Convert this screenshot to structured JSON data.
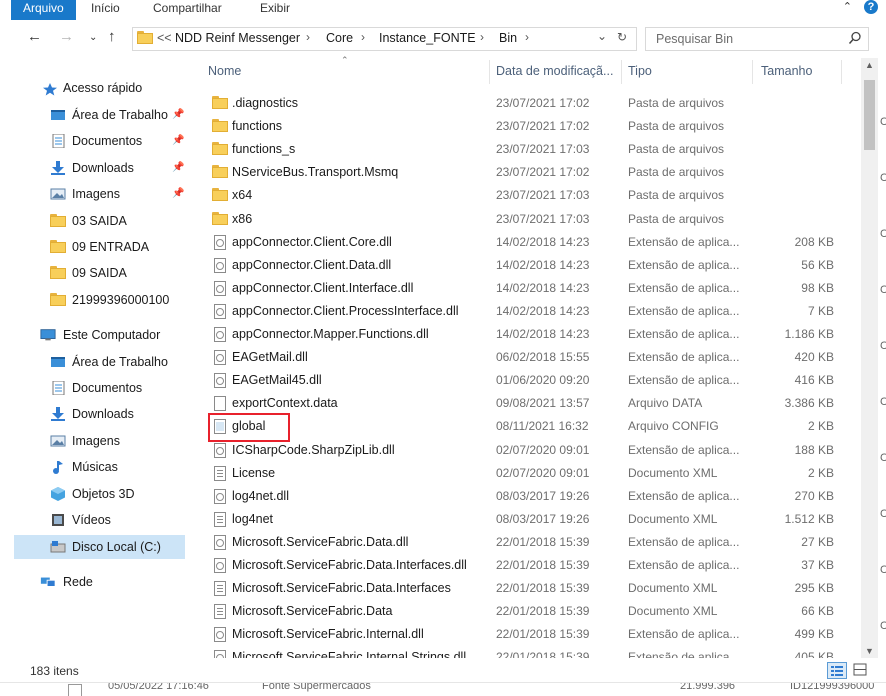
{
  "ribbon": {
    "tabs": [
      "Arquivo",
      "Início",
      "Compartilhar",
      "Exibir"
    ],
    "help": "?"
  },
  "address": {
    "overflow": "<<",
    "crumbs": [
      "NDD Reinf Messenger",
      "Core",
      "Instance_FONTE",
      "Bin"
    ]
  },
  "search": {
    "placeholder": "Pesquisar Bin"
  },
  "columns": {
    "name": "Nome",
    "date": "Data de modificaçã...",
    "type": "Tipo",
    "size": "Tamanho"
  },
  "nav": [
    {
      "label": "Acesso rápido",
      "icon": "star-icon"
    },
    {
      "label": "Área de Trabalho",
      "icon": "desktop-icon",
      "pinned": true
    },
    {
      "label": "Documentos",
      "icon": "documents-icon",
      "pinned": true
    },
    {
      "label": "Downloads",
      "icon": "download-icon",
      "pinned": true
    },
    {
      "label": "Imagens",
      "icon": "pictures-icon",
      "pinned": true
    },
    {
      "label": "03 SAIDA",
      "icon": "folder-icon"
    },
    {
      "label": "09 ENTRADA",
      "icon": "folder-icon"
    },
    {
      "label": "09 SAIDA",
      "icon": "folder-icon"
    },
    {
      "label": "21999396000100",
      "icon": "folder-icon"
    },
    {
      "label": "Este Computador",
      "icon": "computer-icon"
    },
    {
      "label": "Área de Trabalho",
      "icon": "desktop-icon"
    },
    {
      "label": "Documentos",
      "icon": "documents-icon"
    },
    {
      "label": "Downloads",
      "icon": "download-icon"
    },
    {
      "label": "Imagens",
      "icon": "pictures-icon"
    },
    {
      "label": "Músicas",
      "icon": "music-icon"
    },
    {
      "label": "Objetos 3D",
      "icon": "objects-3d-icon"
    },
    {
      "label": "Vídeos",
      "icon": "videos-icon"
    },
    {
      "label": "Disco Local (C:)",
      "icon": "drive-icon",
      "selected": true
    },
    {
      "label": "Rede",
      "icon": "network-icon"
    }
  ],
  "files": [
    {
      "name": ".diagnostics",
      "date": "23/07/2021 17:02",
      "type": "Pasta de arquivos",
      "size": "",
      "icon": "folder"
    },
    {
      "name": "functions",
      "date": "23/07/2021 17:02",
      "type": "Pasta de arquivos",
      "size": "",
      "icon": "folder"
    },
    {
      "name": "functions_s",
      "date": "23/07/2021 17:03",
      "type": "Pasta de arquivos",
      "size": "",
      "icon": "folder"
    },
    {
      "name": "NServiceBus.Transport.Msmq",
      "date": "23/07/2021 17:02",
      "type": "Pasta de arquivos",
      "size": "",
      "icon": "folder"
    },
    {
      "name": "x64",
      "date": "23/07/2021 17:03",
      "type": "Pasta de arquivos",
      "size": "",
      "icon": "folder"
    },
    {
      "name": "x86",
      "date": "23/07/2021 17:03",
      "type": "Pasta de arquivos",
      "size": "",
      "icon": "folder"
    },
    {
      "name": "appConnector.Client.Core.dll",
      "date": "14/02/2018 14:23",
      "type": "Extensão de aplica...",
      "size": "208 KB",
      "icon": "dll"
    },
    {
      "name": "appConnector.Client.Data.dll",
      "date": "14/02/2018 14:23",
      "type": "Extensão de aplica...",
      "size": "56 KB",
      "icon": "dll"
    },
    {
      "name": "appConnector.Client.Interface.dll",
      "date": "14/02/2018 14:23",
      "type": "Extensão de aplica...",
      "size": "98 KB",
      "icon": "dll"
    },
    {
      "name": "appConnector.Client.ProcessInterface.dll",
      "date": "14/02/2018 14:23",
      "type": "Extensão de aplica...",
      "size": "7 KB",
      "icon": "dll"
    },
    {
      "name": "appConnector.Mapper.Functions.dll",
      "date": "14/02/2018 14:23",
      "type": "Extensão de aplica...",
      "size": "1.186 KB",
      "icon": "dll"
    },
    {
      "name": "EAGetMail.dll",
      "date": "06/02/2018 15:55",
      "type": "Extensão de aplica...",
      "size": "420 KB",
      "icon": "dll"
    },
    {
      "name": "EAGetMail45.dll",
      "date": "01/06/2020 09:20",
      "type": "Extensão de aplica...",
      "size": "416 KB",
      "icon": "dll"
    },
    {
      "name": "exportContext.data",
      "date": "09/08/2021 13:57",
      "type": "Arquivo DATA",
      "size": "3.386 KB",
      "icon": "blank"
    },
    {
      "name": "global",
      "date": "08/11/2021 16:32",
      "type": "Arquivo CONFIG",
      "size": "2 KB",
      "icon": "config"
    },
    {
      "name": "ICSharpCode.SharpZipLib.dll",
      "date": "02/07/2020 09:01",
      "type": "Extensão de aplica...",
      "size": "188 KB",
      "icon": "dll"
    },
    {
      "name": "License",
      "date": "02/07/2020 09:01",
      "type": "Documento XML",
      "size": "2 KB",
      "icon": "xml"
    },
    {
      "name": "log4net.dll",
      "date": "08/03/2017 19:26",
      "type": "Extensão de aplica...",
      "size": "270 KB",
      "icon": "dll"
    },
    {
      "name": "log4net",
      "date": "08/03/2017 19:26",
      "type": "Documento XML",
      "size": "1.512 KB",
      "icon": "xml"
    },
    {
      "name": "Microsoft.ServiceFabric.Data.dll",
      "date": "22/01/2018 15:39",
      "type": "Extensão de aplica...",
      "size": "27 KB",
      "icon": "dll"
    },
    {
      "name": "Microsoft.ServiceFabric.Data.Interfaces.dll",
      "date": "22/01/2018 15:39",
      "type": "Extensão de aplica...",
      "size": "37 KB",
      "icon": "dll"
    },
    {
      "name": "Microsoft.ServiceFabric.Data.Interfaces",
      "date": "22/01/2018 15:39",
      "type": "Documento XML",
      "size": "295 KB",
      "icon": "xml"
    },
    {
      "name": "Microsoft.ServiceFabric.Data",
      "date": "22/01/2018 15:39",
      "type": "Documento XML",
      "size": "66 KB",
      "icon": "xml"
    },
    {
      "name": "Microsoft.ServiceFabric.Internal.dll",
      "date": "22/01/2018 15:39",
      "type": "Extensão de aplica...",
      "size": "499 KB",
      "icon": "dll"
    },
    {
      "name": "Microsoft.ServiceFabric.Internal.Strings.dll",
      "date": "22/01/2018 15:39",
      "type": "Extensão de aplica...",
      "size": "405 KB",
      "icon": "dll"
    }
  ],
  "status": {
    "count": "183 itens"
  },
  "background_row": {
    "date": "05/05/2022 17:16:46",
    "name": "Fonte Supermercados",
    "value": "21.999.396",
    "id": "ID121999396000"
  },
  "colors": {
    "accent": "#1979ca",
    "selection": "#cce4f7",
    "highlight": "#e8212c",
    "folder": "#f8cf5a"
  }
}
